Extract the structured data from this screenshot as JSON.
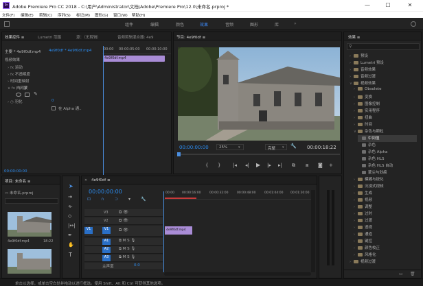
{
  "window": {
    "title": "Adobe Premiere Pro CC 2018 - C:\\用户\\Administrator\\文档\\Adobe\\Premiere Pro\\12.0\\未命名.prproj *",
    "app_icon": "Pr",
    "min": "—",
    "max": "☐",
    "close": "✕"
  },
  "menu": [
    "文件(F)",
    "编辑(E)",
    "剪辑(C)",
    "序列(S)",
    "标记(M)",
    "图形(G)",
    "窗口(W)",
    "帮助(H)"
  ],
  "workspaces": [
    "组件",
    "编辑",
    "颜色",
    "效果",
    "音频",
    "图形",
    "库"
  ],
  "workspace_active": "效果",
  "effect_controls": {
    "tabs": [
      "效果控件 ≡",
      "Lumetri 范围",
      "源：（无剪辑）",
      "音频剪辑混合器: 4e9"
    ],
    "master": "主要 * 4e9f0df.mp4",
    "seq": "4e9f0df * 4e9f0df.mp4",
    "ruler": [
      "00:00",
      "00:00:05:00",
      "00:00:10:00"
    ],
    "clip": "4e9f0df.mp4",
    "section": "视频效果",
    "rows": [
      "运动",
      "不透明度",
      "时间重映射",
      "白闪蒙"
    ],
    "feather_label": "羽化",
    "feather_val": "0",
    "alpha_label": "在 Alpha 通..",
    "timecode": "00:00:00:00"
  },
  "program": {
    "tab": "节目: 4e9f0df ≡",
    "timecode_left": "00:00:00:00",
    "zoom": "25%",
    "quality": "完整",
    "timecode_right": "00:00:18:22"
  },
  "effects": {
    "tab": "效果 ≡",
    "items": [
      {
        "l": "预设",
        "lvl": 0,
        "sel": false
      },
      {
        "l": "Lumetri 预设",
        "lvl": 0,
        "sel": false
      },
      {
        "l": "音频效果",
        "lvl": 0,
        "sel": false
      },
      {
        "l": "音频过渡",
        "lvl": 0,
        "sel": false
      },
      {
        "l": "视频效果",
        "lvl": 0,
        "sel": false
      },
      {
        "l": "Obsolete",
        "lvl": 1,
        "sel": false
      },
      {
        "l": "变换",
        "lvl": 1,
        "sel": false
      },
      {
        "l": "图像控制",
        "lvl": 1,
        "sel": false
      },
      {
        "l": "实用程序",
        "lvl": 1,
        "sel": false
      },
      {
        "l": "扭曲",
        "lvl": 1,
        "sel": false
      },
      {
        "l": "时间",
        "lvl": 1,
        "sel": false
      },
      {
        "l": "杂色与颗粒",
        "lvl": 1,
        "sel": false
      },
      {
        "l": "中间值",
        "lvl": 2,
        "sel": true
      },
      {
        "l": "杂色",
        "lvl": 2,
        "sel": false
      },
      {
        "l": "杂色 Alpha",
        "lvl": 2,
        "sel": false
      },
      {
        "l": "杂色 HLS",
        "lvl": 2,
        "sel": false
      },
      {
        "l": "杂色 HLS 自动",
        "lvl": 2,
        "sel": false
      },
      {
        "l": "蒙尘与划痕",
        "lvl": 2,
        "sel": false
      },
      {
        "l": "模糊与锐化",
        "lvl": 1,
        "sel": false
      },
      {
        "l": "沉浸式视频",
        "lvl": 1,
        "sel": false
      },
      {
        "l": "生成",
        "lvl": 1,
        "sel": false
      },
      {
        "l": "视频",
        "lvl": 1,
        "sel": false
      },
      {
        "l": "调整",
        "lvl": 1,
        "sel": false
      },
      {
        "l": "过时",
        "lvl": 1,
        "sel": false
      },
      {
        "l": "过渡",
        "lvl": 1,
        "sel": false
      },
      {
        "l": "透视",
        "lvl": 1,
        "sel": false
      },
      {
        "l": "通道",
        "lvl": 1,
        "sel": false
      },
      {
        "l": "键控",
        "lvl": 1,
        "sel": false
      },
      {
        "l": "颜色校正",
        "lvl": 1,
        "sel": false
      },
      {
        "l": "风格化",
        "lvl": 1,
        "sel": false
      },
      {
        "l": "视频过渡",
        "lvl": 0,
        "sel": false
      }
    ]
  },
  "project": {
    "tab": "项目: 未命名 ≡",
    "file": "未命名.prproj",
    "clip1": "4e9f0df.mp4",
    "clip1_dur": "18:22"
  },
  "timeline": {
    "tab": "4e9f0df ≡",
    "timecode": "00:00:00:00",
    "ruler": [
      "00:00",
      "00:00:16:00",
      "00:00:32:00",
      "00:00:48:00",
      "00:01:04:00",
      "00:01:20:00"
    ],
    "tracks_v": [
      "V3",
      "V2",
      "V1"
    ],
    "tracks_a": [
      "A1",
      "A2",
      "A3"
    ],
    "master": "主声道",
    "master_val": "0.0",
    "clip": "4e9f0df.mp4"
  },
  "status": "单击以选择，或单击空白处并拖动以进行框选。使用 Shift、Alt 和 Ctrl 可获得其他选项。"
}
